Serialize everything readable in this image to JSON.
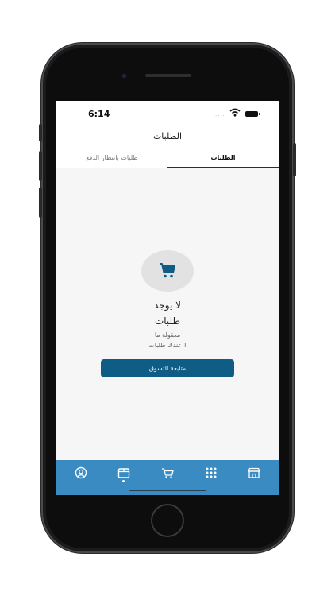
{
  "status_bar": {
    "time": "6:14",
    "signal": "....",
    "icons": [
      "wifi-icon",
      "battery-icon"
    ]
  },
  "header": {
    "title": "الطلبات"
  },
  "tabs": [
    {
      "label": "طلبات بانتظار الدفع",
      "active": false
    },
    {
      "label": "الطلبات",
      "active": true
    }
  ],
  "empty_state": {
    "icon": "cart-icon",
    "title_line1": "لا يوجد",
    "title_line2": "طلبات",
    "subtitle_line1": "معقولة ما",
    "subtitle_line2": "عندك طلبات !",
    "button_label": "متابعة التسوق"
  },
  "bottom_nav": {
    "items": [
      "profile-icon",
      "orders-icon",
      "cart-icon",
      "apps-icon",
      "store-icon"
    ],
    "active_item": "orders-icon"
  },
  "colors": {
    "accent": "#0f5c84",
    "nav_background": "#3a8bc2",
    "tab_underline": "#16324f"
  }
}
